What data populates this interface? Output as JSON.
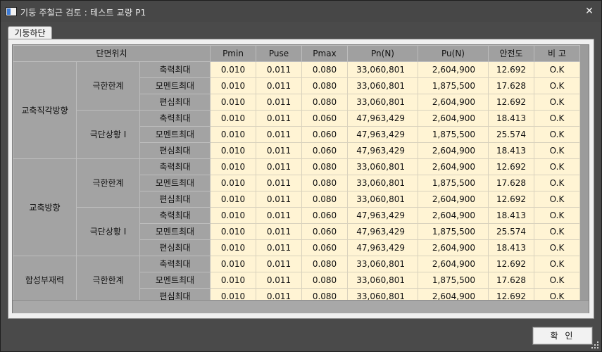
{
  "window": {
    "title": "기둥 주철근 검토 : 테스트 교량 P1",
    "close_glyph": "✕",
    "app_icon": "window-app-icon"
  },
  "tabs": [
    {
      "label": "기둥하단"
    }
  ],
  "grid": {
    "columns": {
      "section": "단면위치",
      "pmin": "Pmin",
      "puse": "Puse",
      "pmax": "Pmax",
      "pn": "Pn(N)",
      "pu": "Pu(N)",
      "safety": "안전도",
      "remark": "비 고"
    },
    "groups": [
      {
        "name": "교축직각방향",
        "limits": [
          {
            "name": "극한한계",
            "rows": [
              {
                "case": "축력최대",
                "pmin": "0.010",
                "puse": "0.011",
                "pmax": "0.080",
                "pn": "33,060,801",
                "pu": "2,604,900",
                "safety": "12.692",
                "remark": "O.K"
              },
              {
                "case": "모멘트최대",
                "pmin": "0.010",
                "puse": "0.011",
                "pmax": "0.080",
                "pn": "33,060,801",
                "pu": "1,875,500",
                "safety": "17.628",
                "remark": "O.K"
              },
              {
                "case": "편심최대",
                "pmin": "0.010",
                "puse": "0.011",
                "pmax": "0.080",
                "pn": "33,060,801",
                "pu": "2,604,900",
                "safety": "12.692",
                "remark": "O.K"
              }
            ]
          },
          {
            "name": "극단상황 I",
            "rows": [
              {
                "case": "축력최대",
                "pmin": "0.010",
                "puse": "0.011",
                "pmax": "0.060",
                "pn": "47,963,429",
                "pu": "2,604,900",
                "safety": "18.413",
                "remark": "O.K"
              },
              {
                "case": "모멘트최대",
                "pmin": "0.010",
                "puse": "0.011",
                "pmax": "0.060",
                "pn": "47,963,429",
                "pu": "1,875,500",
                "safety": "25.574",
                "remark": "O.K"
              },
              {
                "case": "편심최대",
                "pmin": "0.010",
                "puse": "0.011",
                "pmax": "0.060",
                "pn": "47,963,429",
                "pu": "2,604,900",
                "safety": "18.413",
                "remark": "O.K"
              }
            ]
          }
        ]
      },
      {
        "name": "교축방향",
        "limits": [
          {
            "name": "극한한계",
            "rows": [
              {
                "case": "축력최대",
                "pmin": "0.010",
                "puse": "0.011",
                "pmax": "0.080",
                "pn": "33,060,801",
                "pu": "2,604,900",
                "safety": "12.692",
                "remark": "O.K"
              },
              {
                "case": "모멘트최대",
                "pmin": "0.010",
                "puse": "0.011",
                "pmax": "0.080",
                "pn": "33,060,801",
                "pu": "1,875,500",
                "safety": "17.628",
                "remark": "O.K"
              },
              {
                "case": "편심최대",
                "pmin": "0.010",
                "puse": "0.011",
                "pmax": "0.080",
                "pn": "33,060,801",
                "pu": "2,604,900",
                "safety": "12.692",
                "remark": "O.K"
              }
            ]
          },
          {
            "name": "극단상황 I",
            "rows": [
              {
                "case": "축력최대",
                "pmin": "0.010",
                "puse": "0.011",
                "pmax": "0.060",
                "pn": "47,963,429",
                "pu": "2,604,900",
                "safety": "18.413",
                "remark": "O.K"
              },
              {
                "case": "모멘트최대",
                "pmin": "0.010",
                "puse": "0.011",
                "pmax": "0.060",
                "pn": "47,963,429",
                "pu": "1,875,500",
                "safety": "25.574",
                "remark": "O.K"
              },
              {
                "case": "편심최대",
                "pmin": "0.010",
                "puse": "0.011",
                "pmax": "0.060",
                "pn": "47,963,429",
                "pu": "2,604,900",
                "safety": "18.413",
                "remark": "O.K"
              }
            ]
          }
        ]
      },
      {
        "name": "합성부재력",
        "limits": [
          {
            "name": "극한한계",
            "rows": [
              {
                "case": "축력최대",
                "pmin": "0.010",
                "puse": "0.011",
                "pmax": "0.080",
                "pn": "33,060,801",
                "pu": "2,604,900",
                "safety": "12.692",
                "remark": "O.K"
              },
              {
                "case": "모멘트최대",
                "pmin": "0.010",
                "puse": "0.011",
                "pmax": "0.080",
                "pn": "33,060,801",
                "pu": "1,875,500",
                "safety": "17.628",
                "remark": "O.K"
              },
              {
                "case": "편심최대",
                "pmin": "0.010",
                "puse": "0.011",
                "pmax": "0.080",
                "pn": "33,060,801",
                "pu": "2,604,900",
                "safety": "12.692",
                "remark": "O.K"
              }
            ]
          }
        ]
      }
    ]
  },
  "buttons": {
    "ok_label": "확 인"
  },
  "colors": {
    "value_cell_bg": "#fff4d4",
    "label_cell_bg": "#a3a3a3",
    "window_bg": "#4a4a4a"
  }
}
